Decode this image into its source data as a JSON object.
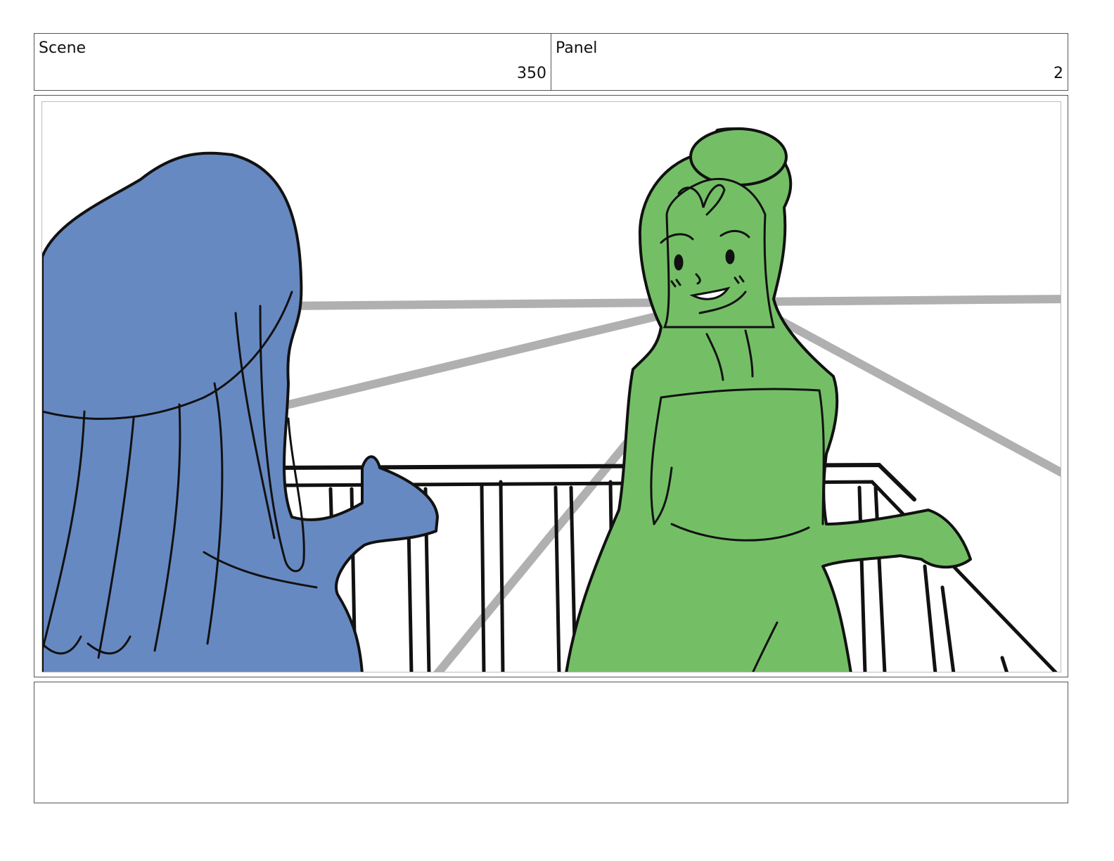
{
  "header": {
    "scene_label": "Scene",
    "scene_value": "350",
    "panel_label": "Panel",
    "panel_value": "2"
  },
  "artwork": {
    "left_character_color": "#6789c2",
    "right_character_color": "#74bf66",
    "perspective_line_color": "#b0b0b0",
    "ink_color": "#111111"
  },
  "notes": {
    "text": ""
  }
}
